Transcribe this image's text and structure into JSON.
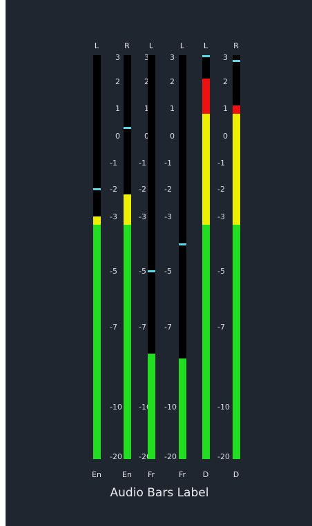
{
  "panel": {
    "title": "Audio Bars Label",
    "scale": [
      "3",
      "2",
      "1",
      "0",
      "-1",
      "-2",
      "-3",
      "-5",
      "-7",
      "-10",
      "-20"
    ],
    "colors": {
      "background": "#1f2630",
      "track": "#000000",
      "green": "#22dd22",
      "yellow": "#eeee00",
      "red": "#ee1111",
      "peak": "#5ad8e8"
    },
    "channels": [
      {
        "channel": "L",
        "language": "En",
        "level_db": -3.0,
        "peak_db": -2.0
      },
      {
        "channel": "R",
        "language": "En",
        "level_db": -2.2,
        "peak_db": 0.3
      },
      {
        "channel": "L",
        "language": "Fr",
        "level_db": -8.0,
        "peak_db": -5.0
      },
      {
        "channel": "L",
        "language": "Fr",
        "level_db": -8.2,
        "peak_db": -4.0
      },
      {
        "channel": "L",
        "language": "D",
        "level_db": 2.1,
        "peak_db": 3.0
      },
      {
        "channel": "R",
        "language": "D",
        "level_db": 1.1,
        "peak_db": 2.8
      }
    ]
  }
}
